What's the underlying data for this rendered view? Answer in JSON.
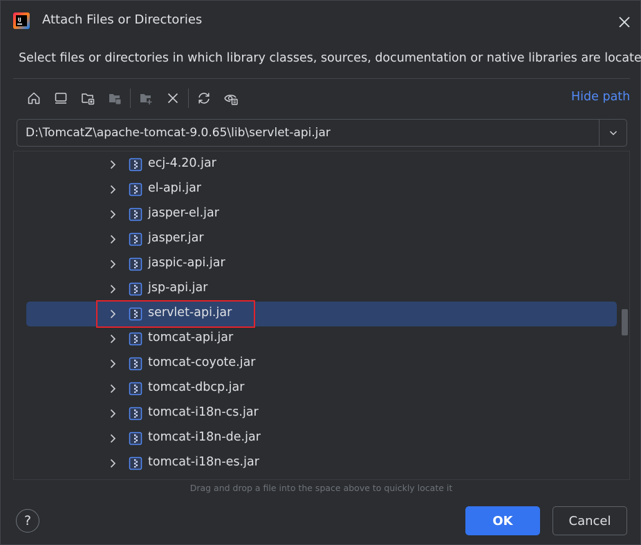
{
  "dialog": {
    "title": "Attach Files or Directories",
    "description": "Select files or directories in which library classes, sources, documentation or native libraries are located"
  },
  "toolbar": {
    "icons": [
      "home-icon",
      "desktop-icon",
      "project-folder-icon",
      "module-folder-icon",
      "new-folder-icon",
      "delete-icon",
      "refresh-icon",
      "show-hidden-icon"
    ],
    "hide_path_label": "Hide path"
  },
  "path": {
    "value": "D:\\TomcatZ\\apache-tomcat-9.0.65\\lib\\servlet-api.jar"
  },
  "tree": {
    "items": [
      {
        "label": "ecj-4.20.jar"
      },
      {
        "label": "el-api.jar"
      },
      {
        "label": "jasper-el.jar"
      },
      {
        "label": "jasper.jar"
      },
      {
        "label": "jaspic-api.jar"
      },
      {
        "label": "jsp-api.jar"
      },
      {
        "label": "servlet-api.jar",
        "selected": true
      },
      {
        "label": "tomcat-api.jar"
      },
      {
        "label": "tomcat-coyote.jar"
      },
      {
        "label": "tomcat-dbcp.jar"
      },
      {
        "label": "tomcat-i18n-cs.jar"
      },
      {
        "label": "tomcat-i18n-de.jar"
      },
      {
        "label": "tomcat-i18n-es.jar"
      }
    ]
  },
  "hint": "Drag and drop a file into the space above to quickly locate it",
  "footer": {
    "help_label": "?",
    "ok_label": "OK",
    "cancel_label": "Cancel"
  },
  "colors": {
    "background": "#2b2d30",
    "accent": "#3574f0",
    "link": "#548af7",
    "selection": "#2e436e",
    "highlight_box": "#e0242b"
  }
}
